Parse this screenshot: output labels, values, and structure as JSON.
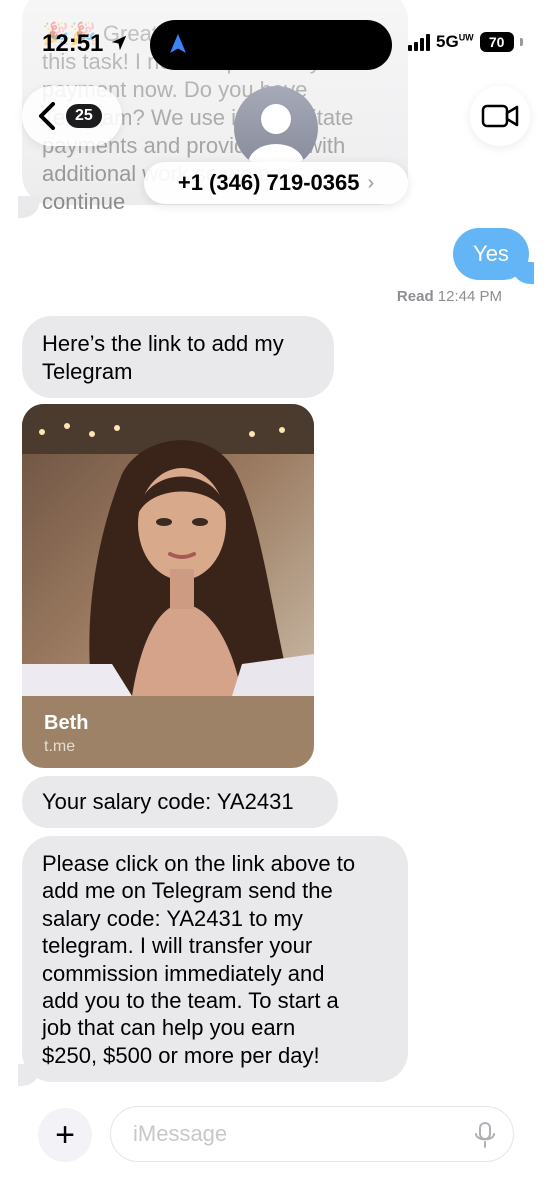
{
  "status_bar": {
    "time": "12:51",
    "network": "5G",
    "network_suffix": "UW",
    "battery": "70"
  },
  "nav": {
    "back_badge": "25",
    "contact_name": "+1 (346) 719-0365",
    "contact_chevron": "›"
  },
  "messages": {
    "top_faded": {
      "line1": "🎉🎉 Great job on completing",
      "line2": "this task! I need to process your",
      "line3": "payment now. Do you have",
      "line4": "Telegram? We use it to facilitate",
      "line5": "payments and provide you with",
      "line6": "additional work so we can",
      "line7": "continue"
    },
    "outgoing_yes": "Yes",
    "read_label": "Read",
    "read_time": "12:44 PM",
    "msg1_line1": "Here’s the link to add my",
    "msg1_line2": "Telegram",
    "link_title": "Beth",
    "link_url": "t.me",
    "msg2": "Your salary code: YA2431",
    "msg3_lines": [
      "Please click on the link above to",
      "add me on Telegram send the",
      "salary code: YA2431 to my",
      "telegram. I will transfer your",
      "commission immediately and",
      "add you to the team. To start a",
      "job that can help you earn",
      "$250, $500 or more per day!"
    ]
  },
  "compose": {
    "placeholder": "iMessage",
    "plus_label": "+"
  },
  "colors": {
    "incoming_bubble": "#e9e9eb",
    "outgoing_bubble": "#64b5f6",
    "link_card": "#9d8267"
  }
}
